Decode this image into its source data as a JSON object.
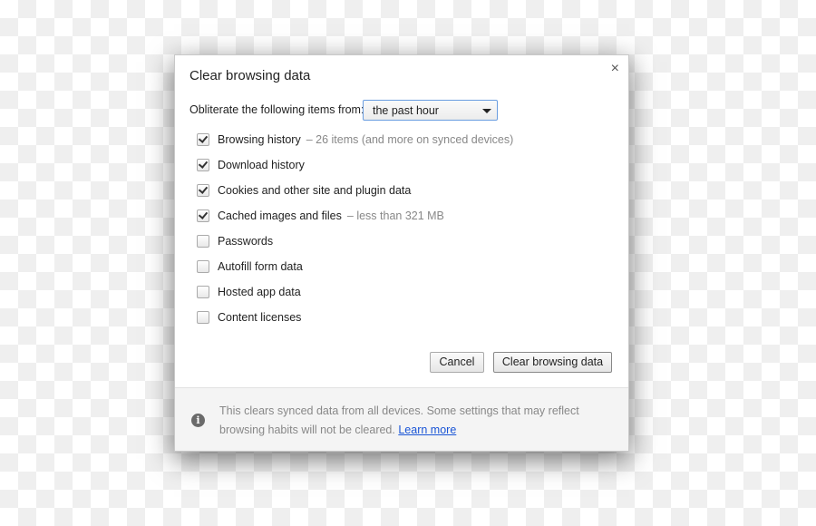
{
  "dialog": {
    "title": "Clear browsing data",
    "close_icon": "×",
    "from_label": "Obliterate the following items from:",
    "time_range": "the past hour",
    "items": [
      {
        "label": "Browsing history",
        "detail": "–  26 items (and more on synced devices)",
        "checked": true
      },
      {
        "label": "Download history",
        "detail": "",
        "checked": true
      },
      {
        "label": "Cookies and other site and plugin data",
        "detail": "",
        "checked": true
      },
      {
        "label": "Cached images and files",
        "detail": "–  less than 321 MB",
        "checked": true
      },
      {
        "label": "Passwords",
        "detail": "",
        "checked": false
      },
      {
        "label": "Autofill form data",
        "detail": "",
        "checked": false
      },
      {
        "label": "Hosted app data",
        "detail": "",
        "checked": false
      },
      {
        "label": "Content licenses",
        "detail": "",
        "checked": false
      }
    ],
    "cancel_label": "Cancel",
    "clear_label": "Clear browsing data",
    "footer": {
      "icon": "info-icon",
      "text": "This clears synced data from all devices. Some settings that may reflect browsing habits will not be cleared.",
      "link": "Learn more"
    }
  }
}
